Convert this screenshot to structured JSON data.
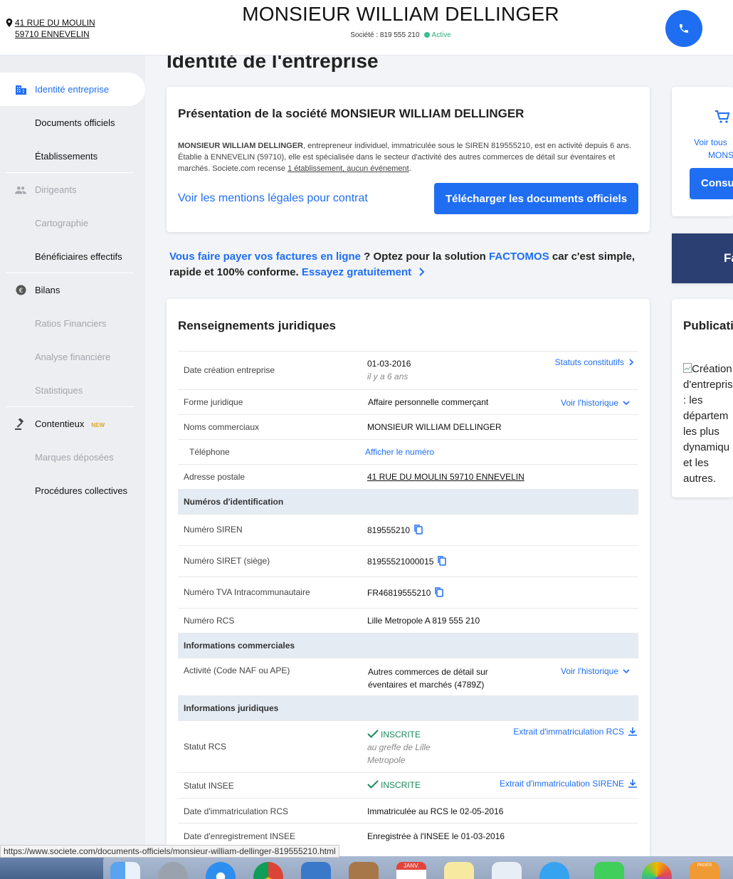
{
  "header": {
    "address_line1": "41 RUE DU MOULIN",
    "address_line2": "59710 ENNEVELIN",
    "company_name": "MONSIEUR WILLIAM DELLINGER",
    "societe_label": "Société : 819 555 210",
    "status": "Active",
    "status_color": "#3bbf8c"
  },
  "sidebar": {
    "items": [
      {
        "label": "Identité entreprise",
        "icon": "building-icon"
      },
      {
        "label": "Documents officiels"
      },
      {
        "label": "Établissements"
      },
      {
        "label": "Dirigeants",
        "icon": "people-icon"
      },
      {
        "label": "Cartographie"
      },
      {
        "label": "Bénéficiaires effectifs"
      },
      {
        "label": "Bilans",
        "icon": "euro-icon"
      },
      {
        "label": "Ratios Financiers"
      },
      {
        "label": "Analyse financière"
      },
      {
        "label": "Statistiques"
      },
      {
        "label": "Contentieux",
        "icon": "gavel-icon",
        "badge": "NEW"
      },
      {
        "label": "Marques déposées"
      },
      {
        "label": "Procédures collectives"
      }
    ]
  },
  "main": {
    "heading": "Identité de l'entreprise",
    "presentation": {
      "title": "Présentation de la société MONSIEUR WILLIAM DELLINGER",
      "text_bold": "MONSIEUR WILLIAM DELLINGER",
      "text_rest": ", entrepreneur individuel, immatriculée sous le SIREN 819555210, est en activité depuis 6 ans. Établie à ENNEVELIN (59710), elle est spécialisée dans le secteur d'activité des autres commerces de détail sur éventaires et marchés. Societe.com recense ",
      "text_link": "1 établissement, aucun événement",
      "text_end": ".",
      "legal_link": "Voir les mentions légales pour contrat",
      "download_button": "Télécharger les documents officiels"
    },
    "promo": {
      "part1": "Vous faire payer vos factures en ligne",
      "part2": " ? Optez pour la solution ",
      "part3": "FACTOMOS",
      "part4": " car c'est simple, rapide et 100% conforme. ",
      "part5": "Essayez gratuitement"
    },
    "legal": {
      "title": "Renseignements juridiques",
      "creation_date_label": "Date création entreprise",
      "creation_date": "01-03-2016",
      "creation_ago": "il y a 6 ans",
      "statuts_link": "Statuts constitutifs",
      "forme_label": "Forme juridique",
      "forme_value": "Affaire personnelle commerçant",
      "history_link": "Voir l'historique",
      "noms_label": "Noms commerciaux",
      "noms_value": "MONSIEUR WILLIAM DELLINGER",
      "tel_label": "Téléphone",
      "tel_link": "Afficher le numéro",
      "adresse_label": "Adresse postale",
      "adresse_value": "41 RUE DU MOULIN 59710 ENNEVELIN",
      "section_ident": "Numéros d'identification",
      "siren_label": "Numéro SIREN",
      "siren_value": "819555210",
      "siret_label": "Numéro SIRET (siège)",
      "siret_value": "81955521000015",
      "tva_label": "Numéro TVA Intracommunautaire",
      "tva_value": "FR46819555210",
      "rcs_label": "Numéro RCS",
      "rcs_value": "Lille Metropole A 819 555 210",
      "section_comm": "Informations commerciales",
      "activite_label": "Activité (Code NAF ou APE)",
      "activite_value1": "Autres commerces de détail sur",
      "activite_value2": "éventaires et marchés (4789Z)",
      "history_link2": "Voir l'historique",
      "section_jur": "Informations juridiques",
      "statut_rcs_label": "Statut RCS",
      "statut_rcs_value": "INSCRITE",
      "statut_rcs_sub1": "au greffe de Lille",
      "statut_rcs_sub2": "Metropole",
      "extrait_rcs": "Extrait d'immatriculation RCS",
      "statut_insee_label": "Statut INSEE",
      "statut_insee_value": "INSCRITE",
      "extrait_sirene": "Extrait d'immatriculation SIRENE",
      "date_rcs_label": "Date d'immatriculation RCS",
      "date_rcs_value": "Immatriculée au RCS le 02-05-2016",
      "date_insee_label": "Date d'enregistrement INSEE",
      "date_insee_value": "Enregistrée à l'INSEE le 01-03-2016"
    }
  },
  "right": {
    "voir_tous": "Voir tous",
    "mons": "MONS",
    "consu": "Consu",
    "fa": "Fa",
    "publicati": "Publicati",
    "img_alt_lines": [
      "Création",
      "d'entrepris",
      ": les",
      "départem",
      "les plus",
      "dynamiqu",
      "et les",
      "autres."
    ]
  },
  "statusbar": {
    "url": "https://www.societe.com/documents-officiels/monsieur-william-dellinger-819555210.html"
  },
  "dock": {
    "calendar_month": "JANV.",
    "pages_label": "PAGES"
  }
}
